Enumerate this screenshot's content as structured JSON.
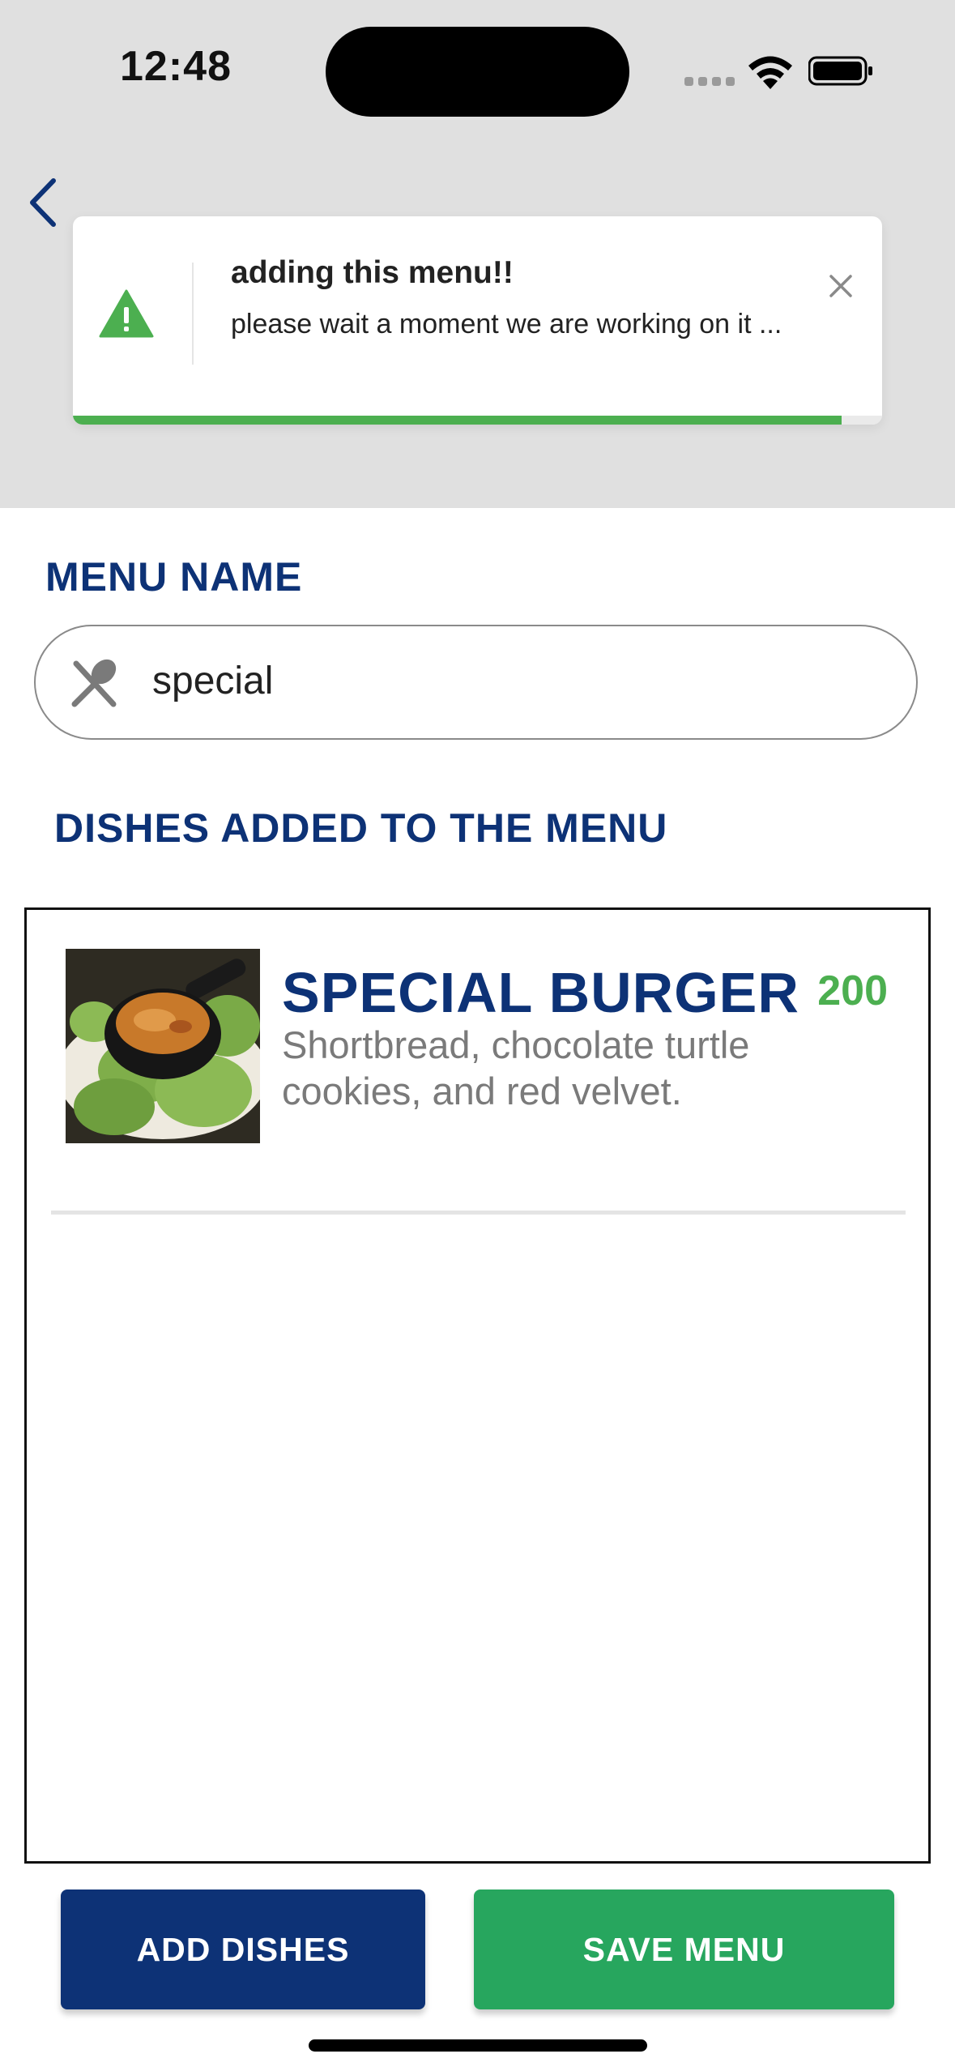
{
  "status_bar": {
    "time": "12:48"
  },
  "toast": {
    "title": "adding this menu!!",
    "message": "please wait a moment we are working on it ...",
    "progress_percent": 95,
    "accent_color": "#4caf50",
    "icon": "warning-icon"
  },
  "form": {
    "menu_name_label": "MENU NAME",
    "menu_name_value": "special",
    "menu_name_icon": "fork-spoon-icon",
    "dishes_label": "DISHES ADDED TO THE MENU"
  },
  "dishes": [
    {
      "name": "SPECIAL BURGER",
      "price": "200",
      "description": "Shortbread, chocolate turtle cookies, and red velvet."
    }
  ],
  "actions": {
    "add_dishes": "ADD DISHES",
    "save_menu": "SAVE MENU"
  },
  "colors": {
    "primary_blue": "#0d3276",
    "primary_green": "#27a65e",
    "price_green": "#4caf50"
  }
}
